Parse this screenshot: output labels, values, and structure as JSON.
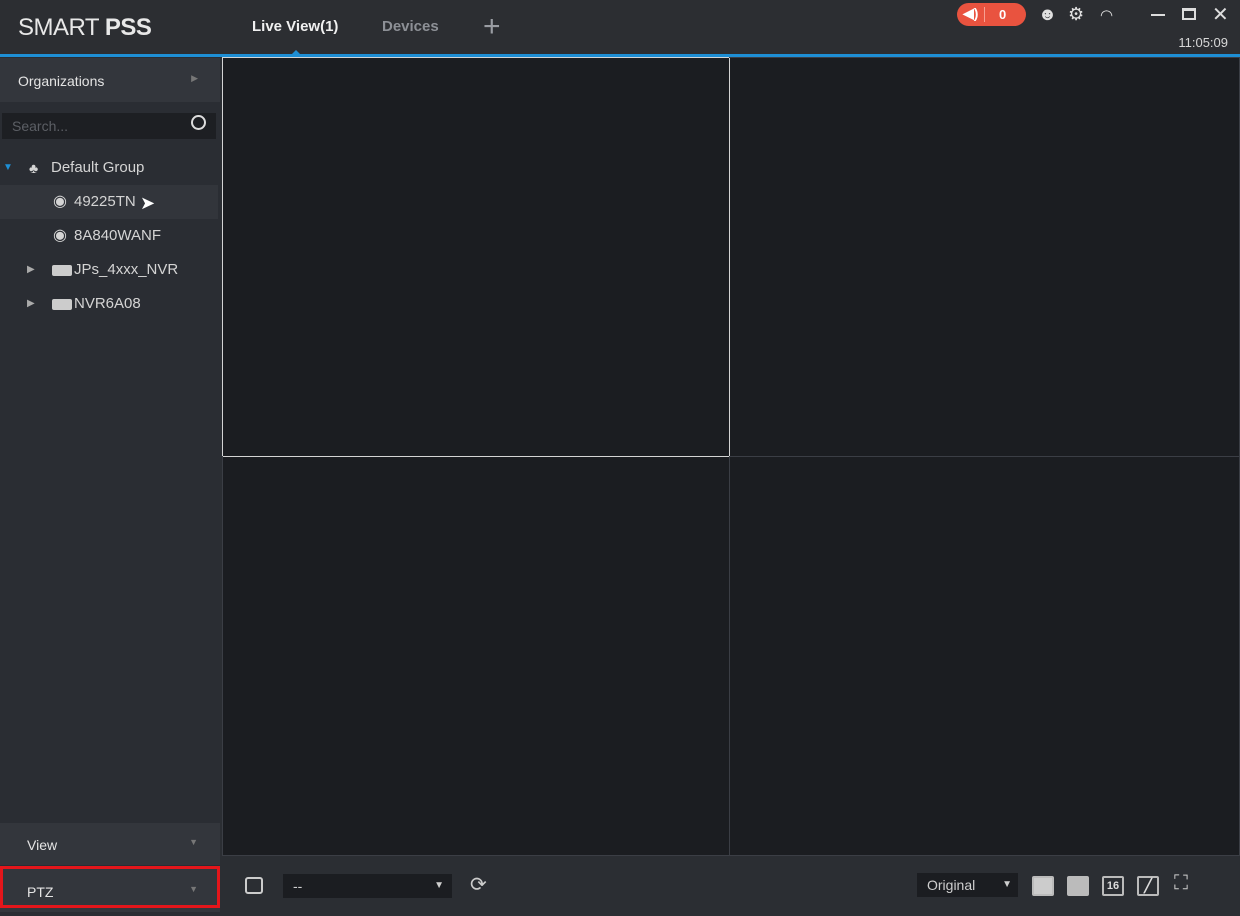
{
  "app": {
    "logo_light": "SMART ",
    "logo_bold": "PSS"
  },
  "tabs": [
    {
      "label": "Live View(1)",
      "active": true
    },
    {
      "label": "Devices",
      "active": false
    }
  ],
  "add_tab": "+",
  "alarm": {
    "count": "0",
    "color": "#e9533f"
  },
  "clock": "11:05:09",
  "accent": "#1e8fd5",
  "sidebar": {
    "organizations": "Organizations",
    "search_placeholder": "Search...",
    "tree": [
      {
        "label": "Default Group",
        "icon": "group-icon",
        "expanded": true
      },
      {
        "label": "49225TN",
        "icon": "camera-icon",
        "hovered": true
      },
      {
        "label": "8A840WANF",
        "icon": "camera-icon"
      },
      {
        "label": "JPs_4xxx_NVR",
        "icon": "nvr-icon",
        "expanded": false
      },
      {
        "label": "NVR6A08",
        "icon": "nvr-icon",
        "expanded": false
      }
    ],
    "view": "View",
    "ptz": "PTZ"
  },
  "bottom": {
    "view_select": "--",
    "stream_select": "Original",
    "layout_16": "16"
  }
}
